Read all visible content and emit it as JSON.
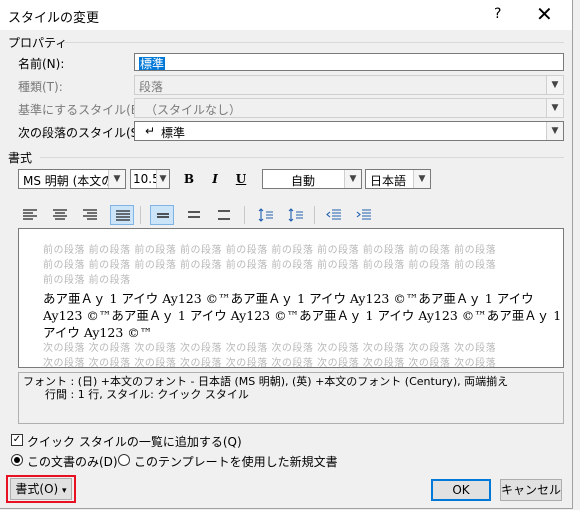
{
  "window": {
    "title": "スタイルの変更",
    "help": "?",
    "close": "✕"
  },
  "properties": {
    "group_label": "プロパティ",
    "name_label": "名前(N):",
    "name_value": "標準",
    "type_label": "種類(T):",
    "type_value": "段落",
    "base_label": "基準にするスタイル(B):",
    "base_value": "（スタイルなし）",
    "next_label": "次の段落のスタイル(S):",
    "next_value": "標準",
    "next_icon": "↵"
  },
  "format": {
    "group_label": "書式",
    "font_family": "MS 明朝 (本文の",
    "font_size": "10.5",
    "bold": "B",
    "italic": "I",
    "underline": "U",
    "color": "自動",
    "language": "日本語"
  },
  "preview": {
    "prev_line1": "前の段落 前の段落 前の段落 前の段落 前の段落 前の段落 前の段落 前の段落 前の段落 前の段落",
    "prev_line2": "前の段落 前の段落 前の段落 前の段落 前の段落 前の段落 前の段落 前の段落 前の段落 前の段落",
    "prev_line3": "前の段落 前の段落",
    "main_line1": "あア亜Ａｙ 1 アイウ Ay123 ©™あア亜Ａｙ 1 アイウ Ay123 ©™あア亜Ａｙ 1 アイウ",
    "main_line2": "Ay123 ©™あア亜Ａｙ 1 アイウ Ay123 ©™あア亜Ａｙ 1 アイウ Ay123 ©™あア亜Ａｙ 1",
    "main_line3": "アイウ Ay123 ©™",
    "next_line1": "次の段落 次の段落 次の段落 次の段落 次の段落 次の段落 次の段落 次の段落 次の段落 次の段落",
    "next_line2": "次の段落 次の段落 次の段落 次の段落 次の段落 次の段落 次の段落 次の段落 次の段落 次の段落"
  },
  "description": {
    "line1": "フォント : (日) +本文のフォント - 日本語 (MS 明朝), (英) +本文のフォント (Century), 両端揃え",
    "line2": "行間 :  1 行, スタイル: クイック スタイル"
  },
  "options": {
    "add_quick_style": "クイック スタイルの一覧に追加する(Q)",
    "add_quick_style_checked": true,
    "this_doc_only": "この文書のみ(D)",
    "new_docs_template": "このテンプレートを使用した新規文書",
    "selected": "this_doc_only"
  },
  "buttons": {
    "format": "書式(O)",
    "format_arrow": "▾",
    "ok": "OK",
    "cancel": "キャンセル"
  }
}
